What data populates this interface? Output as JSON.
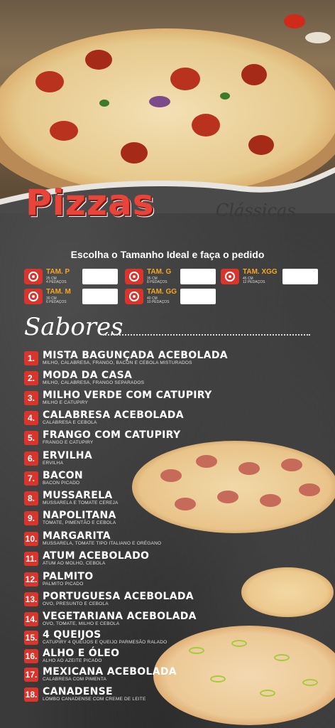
{
  "header": {
    "title": "Pizzas",
    "subtitle": "Clássicas",
    "instruction": "Escolha o Tamanho Ideal e faça o pedido"
  },
  "sizes": [
    {
      "name": "TAM. P",
      "size": "25 CM",
      "slices": "4 PEDAÇOS"
    },
    {
      "name": "TAM. G",
      "size": "35 CM",
      "slices": "8 PEDAÇOS"
    },
    {
      "name": "TAM. XGG",
      "size": "45 CM",
      "slices": "12 PEDAÇOS"
    },
    {
      "name": "TAM. M",
      "size": "30 CM",
      "slices": "6 PEDAÇOS"
    },
    {
      "name": "TAM. GG",
      "size": "40 CM",
      "slices": "10 PEDAÇOS"
    }
  ],
  "sabores_heading": "Sabores",
  "flavors": [
    {
      "num": "1.",
      "name": "MISTA BAGUNÇADA ACEBOLADA",
      "desc": "MILHO, CALABRESA, FRANGO, BACON E CEBOLA MISTURADOS"
    },
    {
      "num": "2.",
      "name": "MODA DA CASA",
      "desc": "MILHO, CALABRESA, FRANGO SEPARADOS"
    },
    {
      "num": "3.",
      "name": "MILHO VERDE COM CATUPIRY",
      "desc": "MILHO E CATUPIRY"
    },
    {
      "num": "4.",
      "name": "CALABRESA ACEBOLADA",
      "desc": "CALABRESA E CEBOLA"
    },
    {
      "num": "5.",
      "name": "FRANGO COM CATUPIRY",
      "desc": "FRANGO E CATUPIRY"
    },
    {
      "num": "6.",
      "name": "ERVILHA",
      "desc": "ERVILHA"
    },
    {
      "num": "7.",
      "name": "BACON",
      "desc": "BACON PICADO"
    },
    {
      "num": "8.",
      "name": "MUSSARELA",
      "desc": "MUSSARELA E TOMATE CEREJA"
    },
    {
      "num": "9.",
      "name": "NAPOLITANA",
      "desc": "TOMATE, PIMENTÃO E CEBOLA"
    },
    {
      "num": "10.",
      "name": "MARGARITA",
      "desc": "MUSSARELA, TOMATE TIPO ITALIANO E ORÉGANO"
    },
    {
      "num": "11.",
      "name": "ATUM ACEBOLADO",
      "desc": "ATUM AO MOLHO, CEBOLA"
    },
    {
      "num": "12.",
      "name": "PALMITO",
      "desc": "PALMITO PICADO"
    },
    {
      "num": "13.",
      "name": "PORTUGUESA ACEBOLADA",
      "desc": "OVO, PRESUNTO E CEBOLA"
    },
    {
      "num": "14.",
      "name": "VEGETARIANA ACEBOLADA",
      "desc": "OVO, TOMATE, MILHO E CEBOLA"
    },
    {
      "num": "15.",
      "name": "4 QUEIJOS",
      "desc": "CATUPIRY 4 QUEIJOS E QUEIJO PARMESÃO RALADO"
    },
    {
      "num": "16.",
      "name": "ALHO E ÓLEO",
      "desc": "ALHO AO AZEITE PICADO"
    },
    {
      "num": "17.",
      "name": "MEXICANA ACEBOLADA",
      "desc": "CALABRESA COM PIMENTA"
    },
    {
      "num": "18.",
      "name": "CANADENSE",
      "desc": "LOMBO CANADENSE COM CREME DE LEITE"
    }
  ],
  "colors": {
    "accent": "#d9352c",
    "size_label": "#f5a623",
    "title": "#e8443a"
  }
}
